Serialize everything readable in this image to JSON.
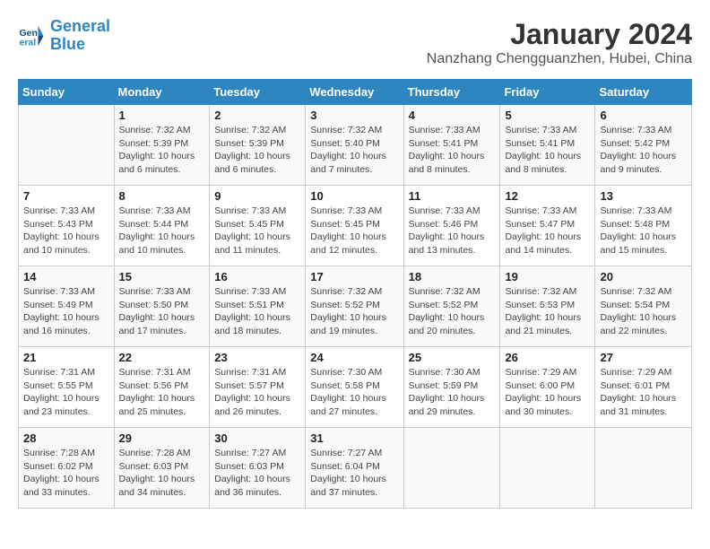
{
  "header": {
    "logo_line1": "General",
    "logo_line2": "Blue",
    "title": "January 2024",
    "subtitle": "Nanzhang Chengguanzhen, Hubei, China"
  },
  "columns": [
    "Sunday",
    "Monday",
    "Tuesday",
    "Wednesday",
    "Thursday",
    "Friday",
    "Saturday"
  ],
  "weeks": [
    [
      {
        "day": "",
        "sunrise": "",
        "sunset": "",
        "daylight": ""
      },
      {
        "day": "1",
        "sunrise": "Sunrise: 7:32 AM",
        "sunset": "Sunset: 5:39 PM",
        "daylight": "Daylight: 10 hours and 6 minutes."
      },
      {
        "day": "2",
        "sunrise": "Sunrise: 7:32 AM",
        "sunset": "Sunset: 5:39 PM",
        "daylight": "Daylight: 10 hours and 6 minutes."
      },
      {
        "day": "3",
        "sunrise": "Sunrise: 7:32 AM",
        "sunset": "Sunset: 5:40 PM",
        "daylight": "Daylight: 10 hours and 7 minutes."
      },
      {
        "day": "4",
        "sunrise": "Sunrise: 7:33 AM",
        "sunset": "Sunset: 5:41 PM",
        "daylight": "Daylight: 10 hours and 8 minutes."
      },
      {
        "day": "5",
        "sunrise": "Sunrise: 7:33 AM",
        "sunset": "Sunset: 5:41 PM",
        "daylight": "Daylight: 10 hours and 8 minutes."
      },
      {
        "day": "6",
        "sunrise": "Sunrise: 7:33 AM",
        "sunset": "Sunset: 5:42 PM",
        "daylight": "Daylight: 10 hours and 9 minutes."
      }
    ],
    [
      {
        "day": "7",
        "sunrise": "Sunrise: 7:33 AM",
        "sunset": "Sunset: 5:43 PM",
        "daylight": "Daylight: 10 hours and 10 minutes."
      },
      {
        "day": "8",
        "sunrise": "Sunrise: 7:33 AM",
        "sunset": "Sunset: 5:44 PM",
        "daylight": "Daylight: 10 hours and 10 minutes."
      },
      {
        "day": "9",
        "sunrise": "Sunrise: 7:33 AM",
        "sunset": "Sunset: 5:45 PM",
        "daylight": "Daylight: 10 hours and 11 minutes."
      },
      {
        "day": "10",
        "sunrise": "Sunrise: 7:33 AM",
        "sunset": "Sunset: 5:45 PM",
        "daylight": "Daylight: 10 hours and 12 minutes."
      },
      {
        "day": "11",
        "sunrise": "Sunrise: 7:33 AM",
        "sunset": "Sunset: 5:46 PM",
        "daylight": "Daylight: 10 hours and 13 minutes."
      },
      {
        "day": "12",
        "sunrise": "Sunrise: 7:33 AM",
        "sunset": "Sunset: 5:47 PM",
        "daylight": "Daylight: 10 hours and 14 minutes."
      },
      {
        "day": "13",
        "sunrise": "Sunrise: 7:33 AM",
        "sunset": "Sunset: 5:48 PM",
        "daylight": "Daylight: 10 hours and 15 minutes."
      }
    ],
    [
      {
        "day": "14",
        "sunrise": "Sunrise: 7:33 AM",
        "sunset": "Sunset: 5:49 PM",
        "daylight": "Daylight: 10 hours and 16 minutes."
      },
      {
        "day": "15",
        "sunrise": "Sunrise: 7:33 AM",
        "sunset": "Sunset: 5:50 PM",
        "daylight": "Daylight: 10 hours and 17 minutes."
      },
      {
        "day": "16",
        "sunrise": "Sunrise: 7:33 AM",
        "sunset": "Sunset: 5:51 PM",
        "daylight": "Daylight: 10 hours and 18 minutes."
      },
      {
        "day": "17",
        "sunrise": "Sunrise: 7:32 AM",
        "sunset": "Sunset: 5:52 PM",
        "daylight": "Daylight: 10 hours and 19 minutes."
      },
      {
        "day": "18",
        "sunrise": "Sunrise: 7:32 AM",
        "sunset": "Sunset: 5:52 PM",
        "daylight": "Daylight: 10 hours and 20 minutes."
      },
      {
        "day": "19",
        "sunrise": "Sunrise: 7:32 AM",
        "sunset": "Sunset: 5:53 PM",
        "daylight": "Daylight: 10 hours and 21 minutes."
      },
      {
        "day": "20",
        "sunrise": "Sunrise: 7:32 AM",
        "sunset": "Sunset: 5:54 PM",
        "daylight": "Daylight: 10 hours and 22 minutes."
      }
    ],
    [
      {
        "day": "21",
        "sunrise": "Sunrise: 7:31 AM",
        "sunset": "Sunset: 5:55 PM",
        "daylight": "Daylight: 10 hours and 23 minutes."
      },
      {
        "day": "22",
        "sunrise": "Sunrise: 7:31 AM",
        "sunset": "Sunset: 5:56 PM",
        "daylight": "Daylight: 10 hours and 25 minutes."
      },
      {
        "day": "23",
        "sunrise": "Sunrise: 7:31 AM",
        "sunset": "Sunset: 5:57 PM",
        "daylight": "Daylight: 10 hours and 26 minutes."
      },
      {
        "day": "24",
        "sunrise": "Sunrise: 7:30 AM",
        "sunset": "Sunset: 5:58 PM",
        "daylight": "Daylight: 10 hours and 27 minutes."
      },
      {
        "day": "25",
        "sunrise": "Sunrise: 7:30 AM",
        "sunset": "Sunset: 5:59 PM",
        "daylight": "Daylight: 10 hours and 29 minutes."
      },
      {
        "day": "26",
        "sunrise": "Sunrise: 7:29 AM",
        "sunset": "Sunset: 6:00 PM",
        "daylight": "Daylight: 10 hours and 30 minutes."
      },
      {
        "day": "27",
        "sunrise": "Sunrise: 7:29 AM",
        "sunset": "Sunset: 6:01 PM",
        "daylight": "Daylight: 10 hours and 31 minutes."
      }
    ],
    [
      {
        "day": "28",
        "sunrise": "Sunrise: 7:28 AM",
        "sunset": "Sunset: 6:02 PM",
        "daylight": "Daylight: 10 hours and 33 minutes."
      },
      {
        "day": "29",
        "sunrise": "Sunrise: 7:28 AM",
        "sunset": "Sunset: 6:03 PM",
        "daylight": "Daylight: 10 hours and 34 minutes."
      },
      {
        "day": "30",
        "sunrise": "Sunrise: 7:27 AM",
        "sunset": "Sunset: 6:03 PM",
        "daylight": "Daylight: 10 hours and 36 minutes."
      },
      {
        "day": "31",
        "sunrise": "Sunrise: 7:27 AM",
        "sunset": "Sunset: 6:04 PM",
        "daylight": "Daylight: 10 hours and 37 minutes."
      },
      {
        "day": "",
        "sunrise": "",
        "sunset": "",
        "daylight": ""
      },
      {
        "day": "",
        "sunrise": "",
        "sunset": "",
        "daylight": ""
      },
      {
        "day": "",
        "sunrise": "",
        "sunset": "",
        "daylight": ""
      }
    ]
  ]
}
